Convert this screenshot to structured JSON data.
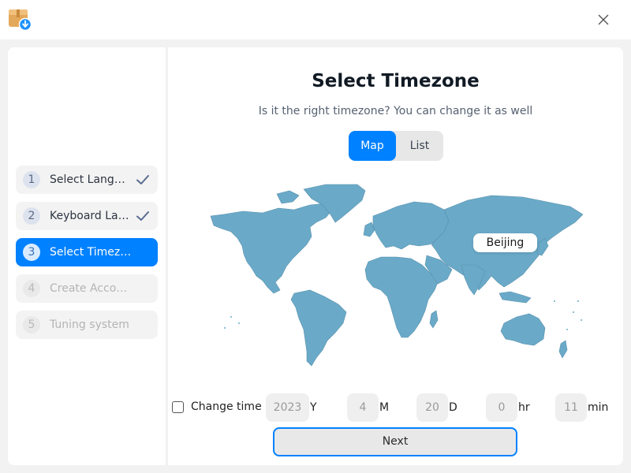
{
  "window": {
    "app_icon": "package-install-icon",
    "close_icon": "close-icon"
  },
  "steps": [
    {
      "number": "1",
      "label": "Select Lang…",
      "state": "done"
    },
    {
      "number": "2",
      "label": "Keyboard La…",
      "state": "done"
    },
    {
      "number": "3",
      "label": "Select Timez…",
      "state": "active"
    },
    {
      "number": "4",
      "label": "Create Acco…",
      "state": "disabled"
    },
    {
      "number": "5",
      "label": "Tuning system",
      "state": "disabled"
    }
  ],
  "main": {
    "title": "Select Timezone",
    "subtitle": "Is it the right timezone? You can change it as well",
    "tabs": [
      {
        "label": "Map",
        "selected": true
      },
      {
        "label": "List",
        "selected": false
      }
    ],
    "map": {
      "selected_city": "Beijing",
      "land_color": "#6aaac8"
    },
    "change_time": {
      "label": "Change time",
      "checked": false,
      "year": "2023",
      "year_unit": "Y",
      "month": "4",
      "month_unit": "M",
      "day": "20",
      "day_unit": "D",
      "hour": "0",
      "hour_unit": "hr",
      "minute": "11",
      "minute_unit": "min"
    },
    "next_label": "Next"
  },
  "colors": {
    "accent": "#0081ff",
    "background": "#f2f2f2"
  }
}
